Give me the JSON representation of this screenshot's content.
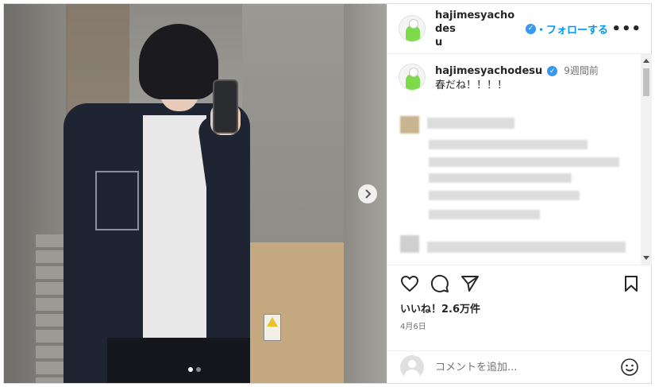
{
  "post": {
    "username_line1": "hajimesyachodes",
    "username_line2": "u",
    "verified_mark": "✓",
    "follow_label": "・フォローする",
    "more_label": "•••"
  },
  "caption": {
    "username": "hajimesyachodesu",
    "verified_mark": "✓",
    "time": "9週間前",
    "text": "春だね！！！！"
  },
  "stats": {
    "likes": "いいね！2.6万件",
    "date": "4月6日"
  },
  "comment_box": {
    "placeholder": "コメントを追加..."
  },
  "carousel": {
    "slide_count": 2,
    "active_slide": 1
  },
  "colors": {
    "accent": "#0095f6",
    "verified": "#3897f0",
    "text": "#262626",
    "muted": "#737373"
  },
  "icons": [
    "heart-icon",
    "comment-icon",
    "share-icon",
    "bookmark-icon",
    "smiley-icon",
    "chevron-right-icon",
    "more-icon",
    "verified-icon"
  ]
}
